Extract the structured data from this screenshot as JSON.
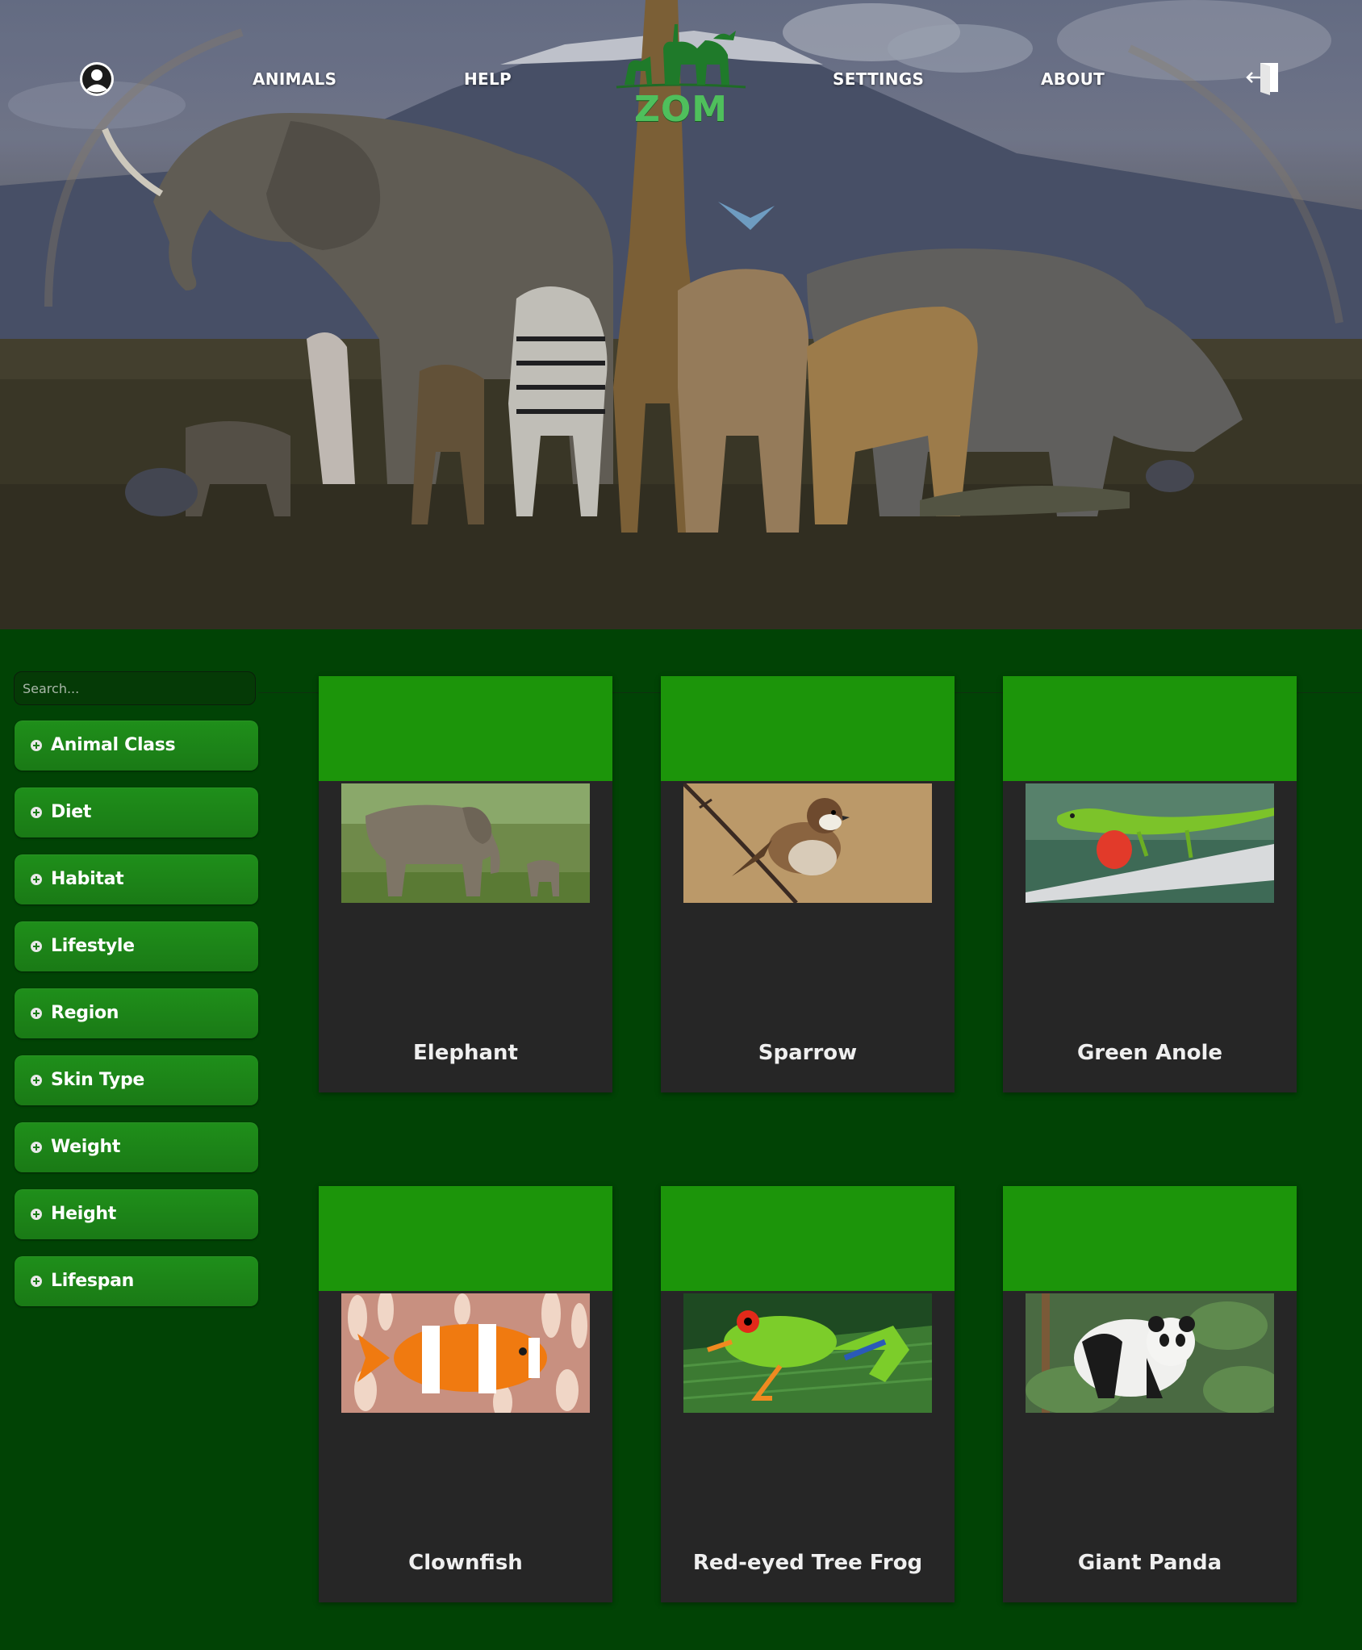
{
  "header": {
    "nav": {
      "animals": "ANIMALS",
      "help": "HELP",
      "settings": "SETTINGS",
      "about": "ABOUT"
    },
    "logo_text": "ZOM",
    "icons": {
      "account": "user-avatar-icon",
      "logout": "logout-door-icon"
    }
  },
  "sidebar": {
    "search_placeholder": "Search...",
    "filters": [
      {
        "label": "Animal Class"
      },
      {
        "label": "Diet"
      },
      {
        "label": "Habitat"
      },
      {
        "label": "Lifestyle"
      },
      {
        "label": "Region"
      },
      {
        "label": "Skin Type"
      },
      {
        "label": "Weight"
      },
      {
        "label": "Height"
      },
      {
        "label": "Lifespan"
      }
    ]
  },
  "animals": [
    {
      "name": "Elephant"
    },
    {
      "name": "Sparrow"
    },
    {
      "name": "Green Anole"
    },
    {
      "name": "Clownfish"
    },
    {
      "name": "Red-eyed Tree Frog"
    },
    {
      "name": "Giant Panda"
    }
  ],
  "colors": {
    "page_background": "#014305",
    "card_band": "#1c950a",
    "card_body": "#262626",
    "filter_button": "#1f8f1a",
    "logo_green": "#4fbf5c"
  }
}
